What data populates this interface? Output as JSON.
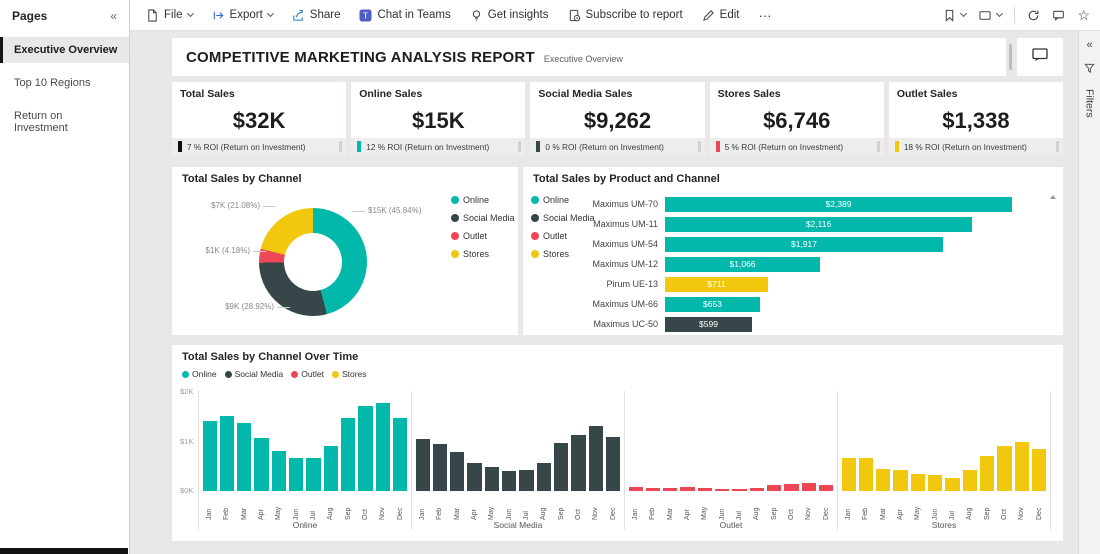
{
  "toolbar": {
    "file": "File",
    "export": "Export",
    "share": "Share",
    "chat": "Chat in Teams",
    "insights": "Get insights",
    "subscribe": "Subscribe to report",
    "edit": "Edit"
  },
  "icons": {
    "more": "···",
    "star": "☆",
    "collapse_pages": "«",
    "expand_filters": "«"
  },
  "pages": {
    "title": "Pages",
    "items": [
      {
        "label": "Executive Overview",
        "active": true
      },
      {
        "label": "Top 10 Regions",
        "active": false
      },
      {
        "label": "Return on Investment",
        "active": false
      }
    ]
  },
  "report": {
    "title": "COMPETITIVE MARKETING ANALYSIS REPORT",
    "subtitle": "Executive Overview"
  },
  "filters_pane": {
    "label": "Filters"
  },
  "kpis": [
    {
      "title": "Total Sales",
      "value": "$32K",
      "roi": "7 % ROI (Return on Investment)",
      "color": "#111111"
    },
    {
      "title": "Online Sales",
      "value": "$15K",
      "roi": "12 % ROI (Return on Investment)",
      "color": "#01B8AA"
    },
    {
      "title": "Social Media Sales",
      "value": "$9,262",
      "roi": "0 % ROI (Return on Investment)",
      "color": "#374649"
    },
    {
      "title": "Stores Sales",
      "value": "$6,746",
      "roi": "5 % ROI (Return on Investment)",
      "color": "#ED4757"
    },
    {
      "title": "Outlet Sales",
      "value": "$1,338",
      "roi": "18 % ROI (Return on Investment)",
      "color": "#F2C80F"
    }
  ],
  "channel_colors": {
    "Online": "#01B8AA",
    "Social Media": "#374649",
    "Outlet": "#ED4757",
    "Stores": "#F2C80F"
  },
  "chart_data": [
    {
      "type": "pie",
      "title": "Total Sales by Channel",
      "legend_position": "right",
      "slices": [
        {
          "label": "Online",
          "value_label": "$15K (45.84%)",
          "pct": 45.84,
          "color": "#01B8AA"
        },
        {
          "label": "Social Media",
          "value_label": "$9K (28.92%)",
          "pct": 28.92,
          "color": "#374649"
        },
        {
          "label": "Outlet",
          "value_label": "$1K (4.18%)",
          "pct": 4.18,
          "color": "#ED4757"
        },
        {
          "label": "Stores",
          "value_label": "$7K (21.08%)",
          "pct": 21.08,
          "color": "#F2C80F"
        }
      ]
    },
    {
      "type": "bar",
      "title": "Total Sales by Product and Channel",
      "orientation": "horizontal",
      "legend": [
        "Online",
        "Social Media",
        "Outlet",
        "Stores"
      ],
      "xmax": 2500,
      "bars": [
        {
          "category": "Maximus UM-70",
          "value": 2389,
          "label": "$2,389",
          "channel": "Online"
        },
        {
          "category": "Maximus UM-11",
          "value": 2116,
          "label": "$2,116",
          "channel": "Online"
        },
        {
          "category": "Maximus UM-54",
          "value": 1917,
          "label": "$1,917",
          "channel": "Online"
        },
        {
          "category": "Maximus UM-12",
          "value": 1066,
          "label": "$1,066",
          "channel": "Online"
        },
        {
          "category": "Pirum UE-13",
          "value": 711,
          "label": "$711",
          "channel": "Stores"
        },
        {
          "category": "Maximus UM-66",
          "value": 653,
          "label": "$653",
          "channel": "Online"
        },
        {
          "category": "Maximus UC-50",
          "value": 599,
          "label": "$599",
          "channel": "Social Media"
        }
      ]
    },
    {
      "type": "bar",
      "title": "Total Sales by Channel Over Time",
      "ylabels": [
        "$2K",
        "$1K",
        "$0K"
      ],
      "ylim": [
        0,
        2000
      ],
      "months": [
        "Jan",
        "Feb",
        "Mar",
        "Apr",
        "May",
        "Jun",
        "Jul",
        "Aug",
        "Sep",
        "Oct",
        "Nov",
        "Dec"
      ],
      "series": [
        {
          "name": "Online",
          "color": "#01B8AA",
          "values": [
            1400,
            1500,
            1350,
            1050,
            800,
            650,
            650,
            900,
            1450,
            1700,
            1750,
            1450
          ]
        },
        {
          "name": "Social Media",
          "color": "#374649",
          "values": [
            1030,
            930,
            780,
            550,
            480,
            390,
            410,
            560,
            950,
            1120,
            1300,
            1080
          ]
        },
        {
          "name": "Outlet",
          "color": "#ED4757",
          "values": [
            80,
            60,
            50,
            70,
            50,
            40,
            30,
            50,
            120,
            140,
            150,
            120
          ]
        },
        {
          "name": "Stores",
          "color": "#F2C80F",
          "values": [
            650,
            660,
            440,
            410,
            340,
            310,
            260,
            410,
            690,
            890,
            980,
            830
          ]
        }
      ]
    }
  ]
}
